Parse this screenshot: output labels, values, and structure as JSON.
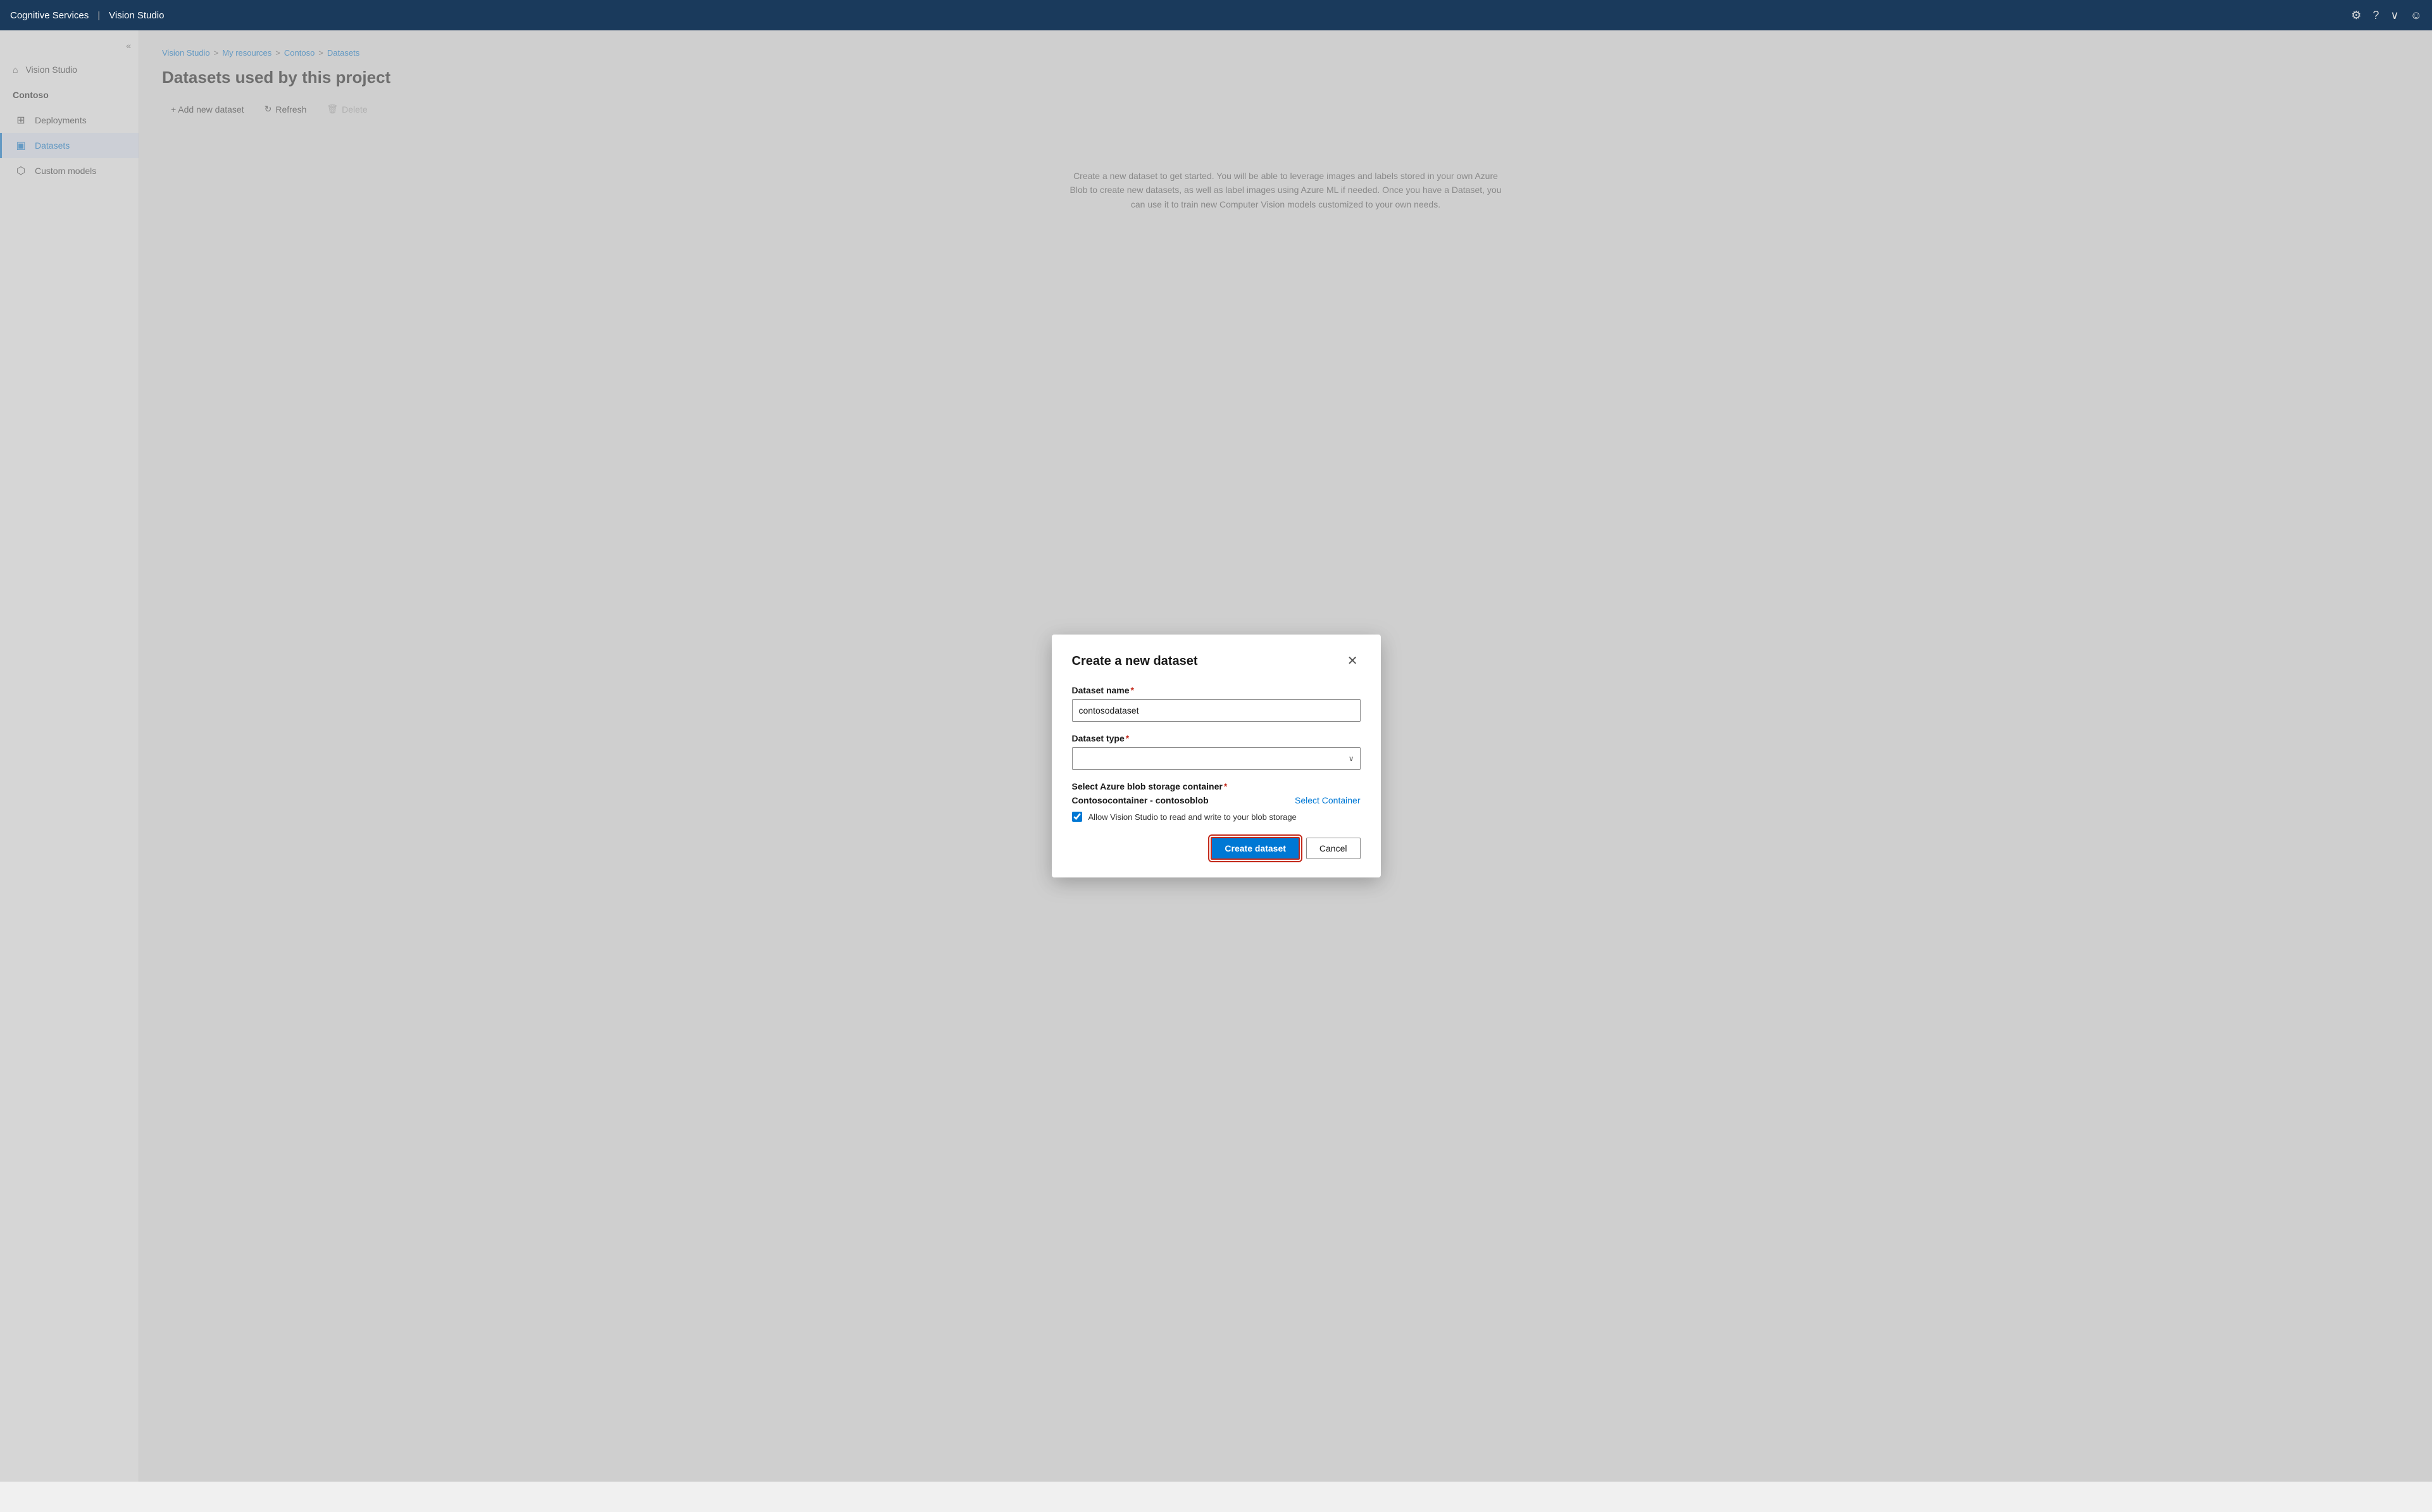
{
  "topbar": {
    "brand": "Cognitive Services",
    "separator": "|",
    "app": "Vision Studio",
    "icons": {
      "settings": "⚙",
      "help": "?",
      "chevron": "∨",
      "user": "☺"
    }
  },
  "sidebar": {
    "collapse_label": "«",
    "org_label": "Contoso",
    "top_item": {
      "label": "Vision Studio",
      "icon": "⌂"
    },
    "items": [
      {
        "id": "deployments",
        "label": "Deployments",
        "icon": "⊞",
        "active": false
      },
      {
        "id": "datasets",
        "label": "Datasets",
        "icon": "▣",
        "active": true
      },
      {
        "id": "custom-models",
        "label": "Custom models",
        "icon": "⬡",
        "active": false
      }
    ]
  },
  "breadcrumb": {
    "items": [
      {
        "label": "Vision Studio",
        "href": "#"
      },
      {
        "label": "My resources",
        "href": "#"
      },
      {
        "label": "Contoso",
        "href": "#"
      },
      {
        "label": "Datasets",
        "href": "#"
      }
    ],
    "separator": ">"
  },
  "page": {
    "title": "Datasets used by this project"
  },
  "toolbar": {
    "add_label": "+ Add new dataset",
    "refresh_label": "Refresh",
    "delete_label": "Delete",
    "refresh_icon": "↻",
    "delete_icon": "🗑"
  },
  "modal": {
    "title": "Create a new dataset",
    "close_icon": "✕",
    "dataset_name_label": "Dataset name",
    "dataset_name_required": "*",
    "dataset_name_value": "contosodataset",
    "dataset_type_label": "Dataset type",
    "dataset_type_required": "*",
    "dataset_type_placeholder": "",
    "storage_label": "Select Azure blob storage container",
    "storage_required": "*",
    "storage_name": "Contosocontainer - contosoblob",
    "select_container_label": "Select Container",
    "checkbox_label": "Allow Vision Studio to read and write to your blob storage",
    "checkbox_checked": true,
    "create_button": "Create dataset",
    "cancel_button": "Cancel"
  },
  "bg_text": "Create a new dataset to get started. You will be able to leverage images and labels stored in your own Azure Blob to create new datasets, as well as label images using Azure ML if needed. Once you have a Dataset, you can use it to train new Computer Vision models customized to your own needs."
}
